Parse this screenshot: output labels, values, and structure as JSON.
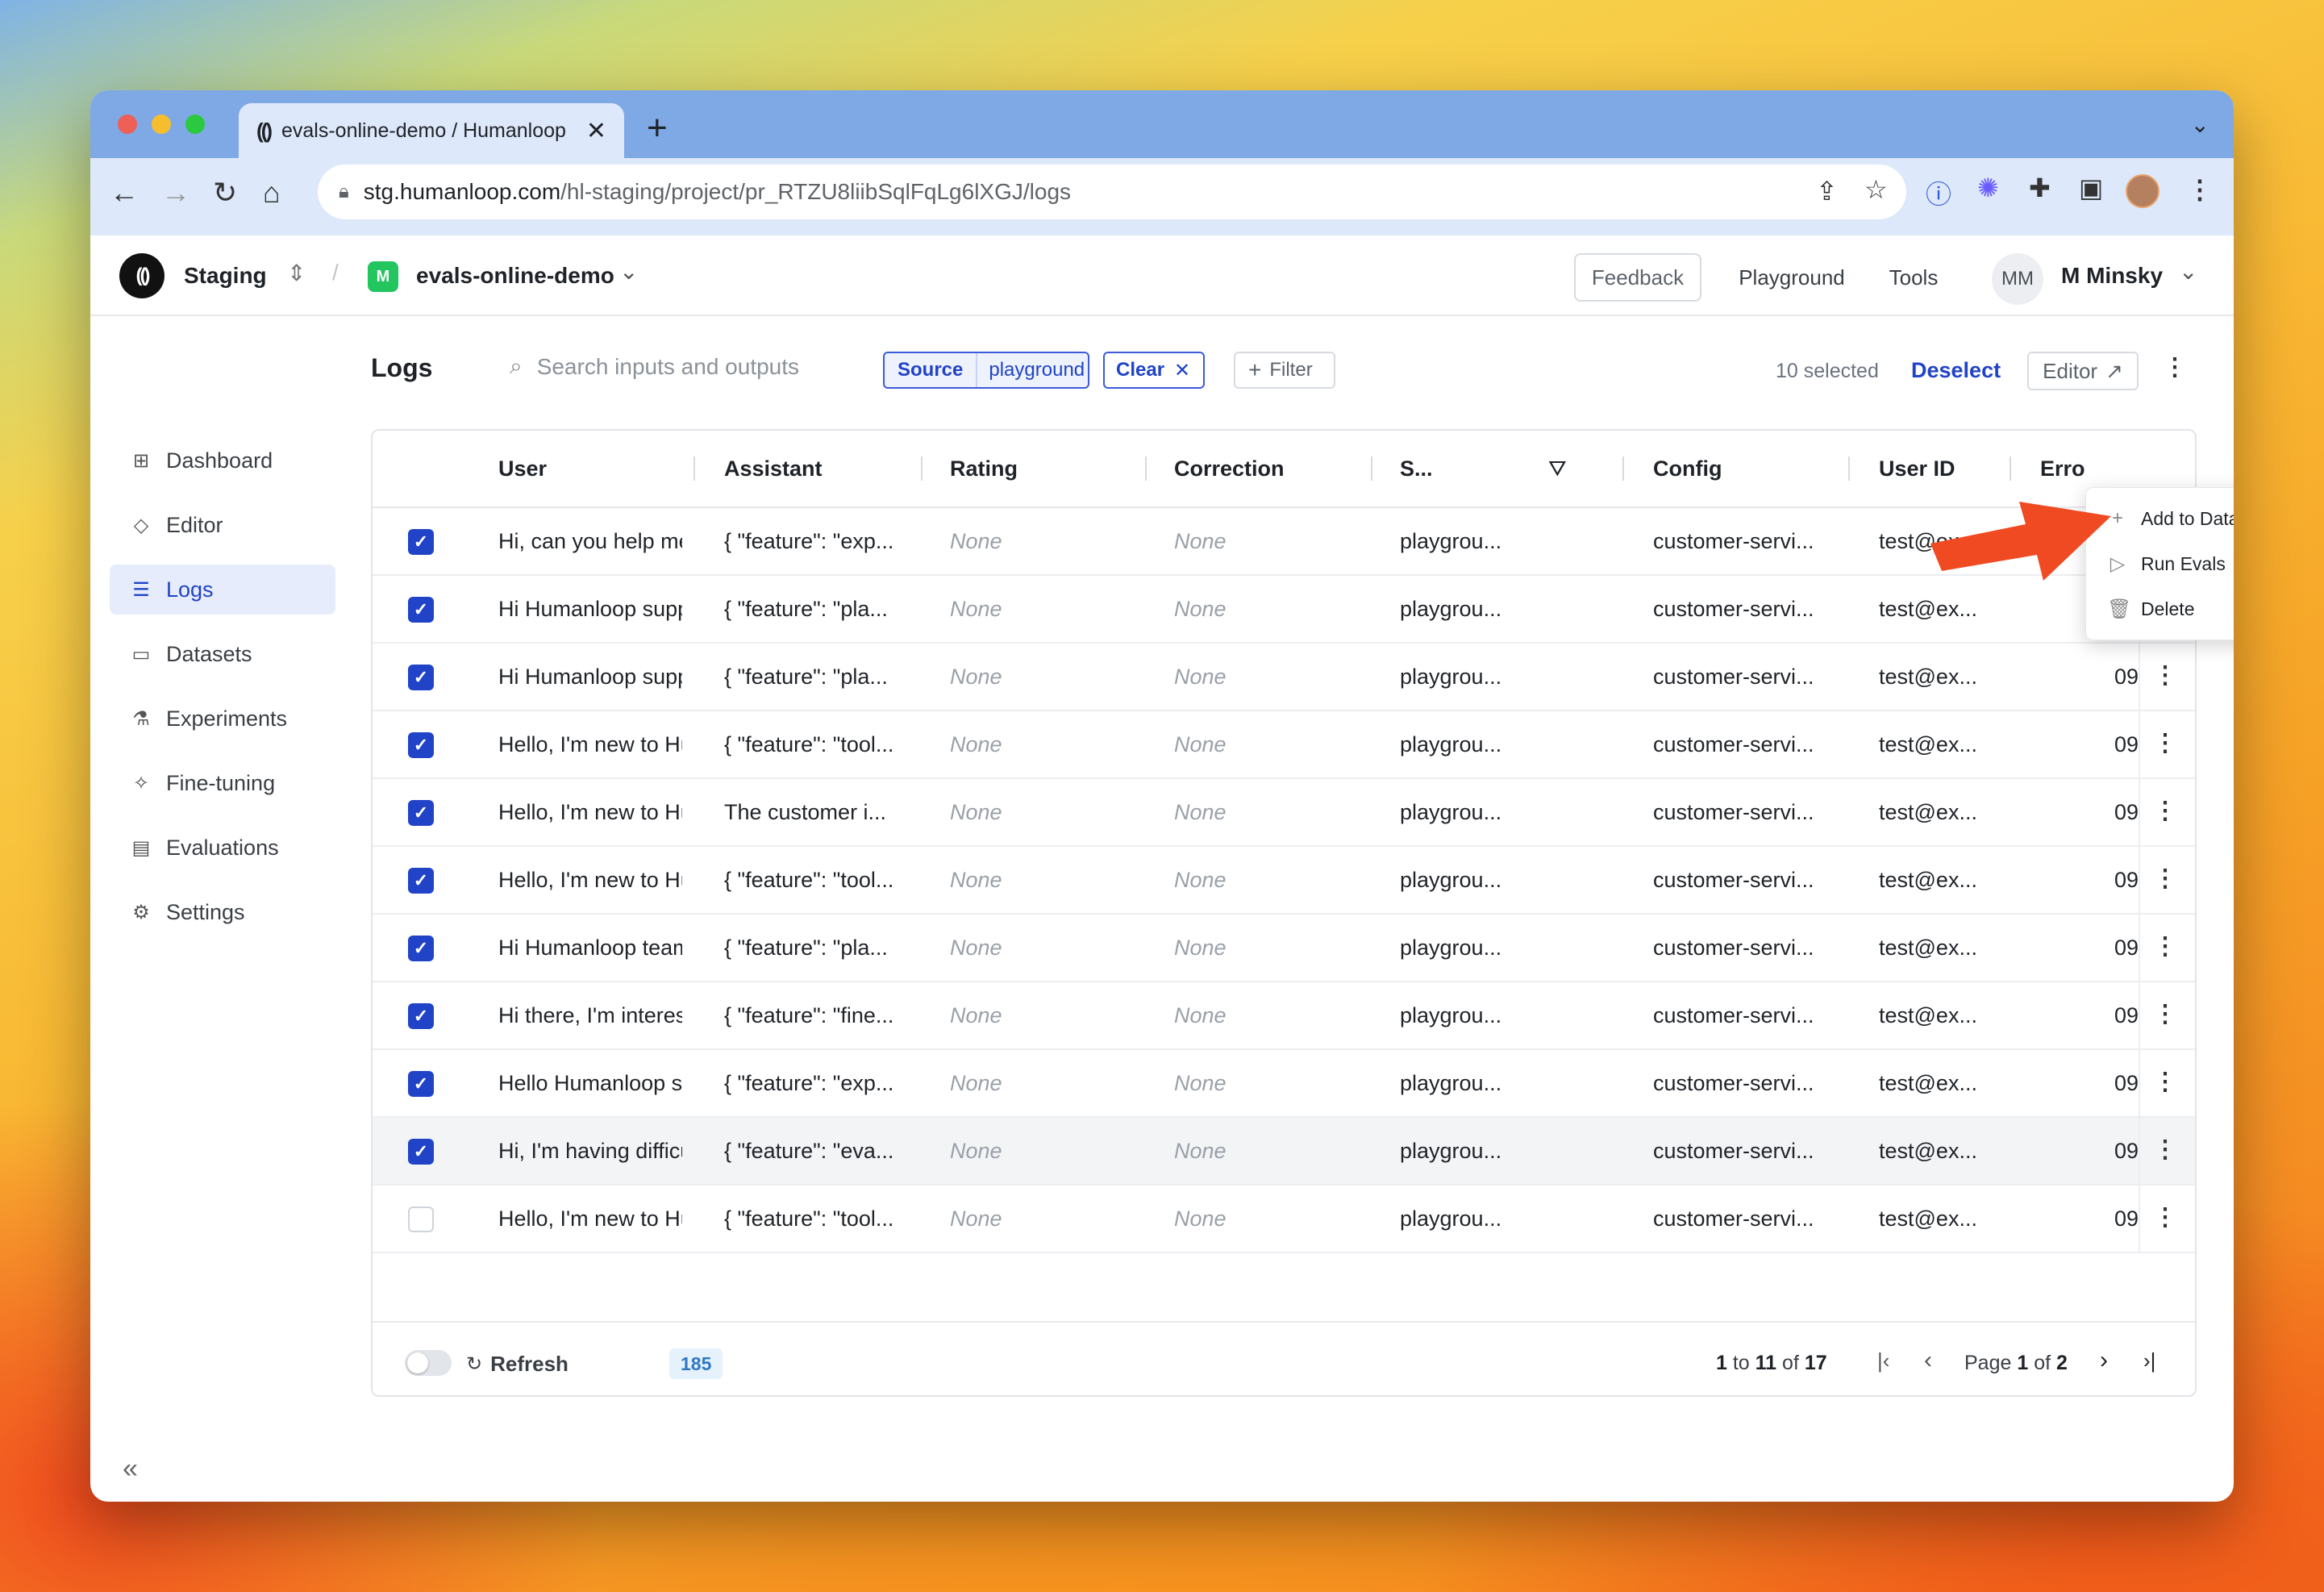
{
  "browser": {
    "tab_title": "evals-online-demo / Humanloop",
    "url_host": "stg.humanloop.com",
    "url_path": "/hl-staging/project/pr_RTZU8liibSqlFqLg6lXGJ/logs"
  },
  "header": {
    "org": "Staging",
    "project": "evals-online-demo",
    "feedback": "Feedback",
    "playground": "Playground",
    "tools": "Tools",
    "user_initials": "MM",
    "user_name": "M Minsky"
  },
  "sidebar": {
    "items": [
      {
        "label": "Dashboard",
        "icon": "grid-icon"
      },
      {
        "label": "Editor",
        "icon": "diamond-icon"
      },
      {
        "label": "Logs",
        "icon": "database-icon"
      },
      {
        "label": "Datasets",
        "icon": "folder-icon"
      },
      {
        "label": "Experiments",
        "icon": "flask-icon"
      },
      {
        "label": "Fine-tuning",
        "icon": "sparkle-icon"
      },
      {
        "label": "Evaluations",
        "icon": "clipboard-icon"
      },
      {
        "label": "Settings",
        "icon": "gear-icon"
      }
    ],
    "active": "Logs"
  },
  "logs": {
    "title": "Logs",
    "search_placeholder": "Search inputs and outputs",
    "filter_key": "Source",
    "filter_value": "playground",
    "clear": "Clear",
    "filter": "Filter",
    "selected": "10 selected",
    "deselect": "Deselect",
    "editor": "Editor"
  },
  "table": {
    "columns": [
      "User",
      "Assistant",
      "Rating",
      "Correction",
      "S...",
      "Config",
      "User ID",
      "Erro"
    ],
    "rows": [
      {
        "checked": true,
        "user": "Hi, can you help me",
        "assistant": "{ \"feature\": \"exp...",
        "rating": "None",
        "correction": "None",
        "source": "playgrou...",
        "config": "customer-servi...",
        "user_id": "test@ex...",
        "date": "09"
      },
      {
        "checked": true,
        "user": "Hi Humanloop suppo",
        "assistant": "{ \"feature\": \"pla...",
        "rating": "None",
        "correction": "None",
        "source": "playgrou...",
        "config": "customer-servi...",
        "user_id": "test@ex...",
        "date": "09"
      },
      {
        "checked": true,
        "user": "Hi Humanloop suppo",
        "assistant": "{ \"feature\": \"pla...",
        "rating": "None",
        "correction": "None",
        "source": "playgrou...",
        "config": "customer-servi...",
        "user_id": "test@ex...",
        "date": "09"
      },
      {
        "checked": true,
        "user": "Hello, I'm new to Hur",
        "assistant": "{ \"feature\": \"tool...",
        "rating": "None",
        "correction": "None",
        "source": "playgrou...",
        "config": "customer-servi...",
        "user_id": "test@ex...",
        "date": "09"
      },
      {
        "checked": true,
        "user": "Hello, I'm new to Hur",
        "assistant": "The customer i...",
        "rating": "None",
        "correction": "None",
        "source": "playgrou...",
        "config": "customer-servi...",
        "user_id": "test@ex...",
        "date": "09"
      },
      {
        "checked": true,
        "user": "Hello, I'm new to Hur",
        "assistant": "{ \"feature\": \"tool...",
        "rating": "None",
        "correction": "None",
        "source": "playgrou...",
        "config": "customer-servi...",
        "user_id": "test@ex...",
        "date": "09"
      },
      {
        "checked": true,
        "user": "Hi Humanloop team,",
        "assistant": "{ \"feature\": \"pla...",
        "rating": "None",
        "correction": "None",
        "source": "playgrou...",
        "config": "customer-servi...",
        "user_id": "test@ex...",
        "date": "09"
      },
      {
        "checked": true,
        "user": "Hi there, I'm interest",
        "assistant": "{ \"feature\": \"fine...",
        "rating": "None",
        "correction": "None",
        "source": "playgrou...",
        "config": "customer-servi...",
        "user_id": "test@ex...",
        "date": "09"
      },
      {
        "checked": true,
        "user": "Hello Humanloop su",
        "assistant": "{ \"feature\": \"exp...",
        "rating": "None",
        "correction": "None",
        "source": "playgrou...",
        "config": "customer-servi...",
        "user_id": "test@ex...",
        "date": "09"
      },
      {
        "checked": true,
        "user": "Hi, I'm having difficul",
        "assistant": "{ \"feature\": \"eva...",
        "rating": "None",
        "correction": "None",
        "source": "playgrou...",
        "config": "customer-servi...",
        "user_id": "test@ex...",
        "date": "09"
      },
      {
        "checked": false,
        "user": "Hello, I'm new to Hur",
        "assistant": "{ \"feature\": \"tool...",
        "rating": "None",
        "correction": "None",
        "source": "playgrou...",
        "config": "customer-servi...",
        "user_id": "test@ex...",
        "date": "09"
      }
    ]
  },
  "footer": {
    "refresh": "Refresh",
    "count": "185",
    "range_from": "1",
    "range_to": "11",
    "range_total": "17",
    "page_current": "1",
    "page_total": "2"
  },
  "menu": {
    "items": [
      {
        "label": "Add to Dataset",
        "icon": "plus-icon"
      },
      {
        "label": "Run Evals",
        "icon": "play-icon"
      },
      {
        "label": "Delete",
        "icon": "trash-icon"
      }
    ]
  },
  "colors": {
    "accent": "#2043c7",
    "arrow": "#f04a23"
  }
}
